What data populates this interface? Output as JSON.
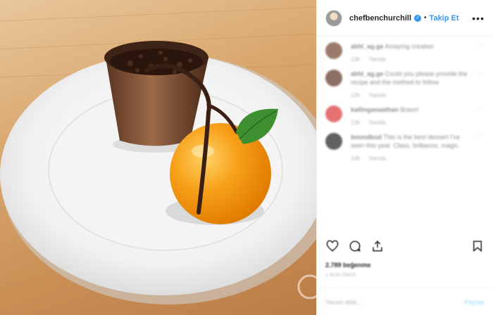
{
  "post": {
    "username": "chefbenchurchill",
    "verified_icon": "check-icon",
    "separator": "•",
    "follow_label": "Takip Et",
    "more_label": "•••"
  },
  "comments": [
    {
      "user": "akhl_ag.ge",
      "text": "Amazing creation",
      "time": "13h",
      "reply": "Yanıtla",
      "avatar_color": "#9c7b6b"
    },
    {
      "user": "akhl_ag.ge",
      "text": "Could you please provide the recipe and the method to follow",
      "time": "13h",
      "reply": "Yanıtla",
      "avatar_color": "#8d6e63"
    },
    {
      "user": "kallinganaathan",
      "text": "Bravo!",
      "time": "13h",
      "reply": "Yanıtla",
      "avatar_color": "#e57373"
    },
    {
      "user": "boondbud",
      "text": "This is the best dessert I've seen this year. Class, brilliance, magic.",
      "time": "14h",
      "reply": "Yanıtla",
      "avatar_color": "#616161"
    }
  ],
  "actions": {
    "like_icon": "heart-icon",
    "comment_icon": "comment-icon",
    "share_icon": "share-icon",
    "save_icon": "bookmark-icon"
  },
  "likes": "2.789 beğenme",
  "time": "1 GÜN ÖNCE",
  "add_comment": {
    "placeholder": "Yorum ekle...",
    "post_label": "Paylaş"
  }
}
